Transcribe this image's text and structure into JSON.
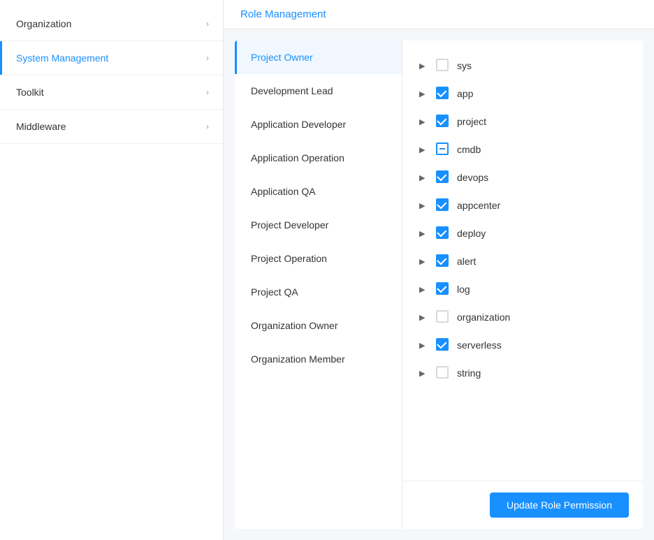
{
  "sidebar": {
    "items": [
      {
        "id": "organization",
        "label": "Organization",
        "active": false,
        "hasChevron": true
      },
      {
        "id": "system-management",
        "label": "System Management",
        "active": true,
        "hasChevron": true
      },
      {
        "id": "toolkit",
        "label": "Toolkit",
        "active": false,
        "hasChevron": true
      },
      {
        "id": "middleware",
        "label": "Middleware",
        "active": false,
        "hasChevron": true
      }
    ]
  },
  "page": {
    "title": "Role Management"
  },
  "roles": [
    {
      "id": "project-owner",
      "label": "Project Owner",
      "active": true
    },
    {
      "id": "development-lead",
      "label": "Development Lead",
      "active": false
    },
    {
      "id": "application-developer",
      "label": "Application Developer",
      "active": false
    },
    {
      "id": "application-operation",
      "label": "Application Operation",
      "active": false
    },
    {
      "id": "application-qa",
      "label": "Application QA",
      "active": false
    },
    {
      "id": "project-developer",
      "label": "Project Developer",
      "active": false
    },
    {
      "id": "project-operation",
      "label": "Project Operation",
      "active": false
    },
    {
      "id": "project-qa",
      "label": "Project QA",
      "active": false
    },
    {
      "id": "organization-owner",
      "label": "Organization Owner",
      "active": false
    },
    {
      "id": "organization-member",
      "label": "Organization Member",
      "active": false
    }
  ],
  "permissions": [
    {
      "id": "sys",
      "label": "sys",
      "state": "unchecked"
    },
    {
      "id": "app",
      "label": "app",
      "state": "checked"
    },
    {
      "id": "project",
      "label": "project",
      "state": "checked"
    },
    {
      "id": "cmdb",
      "label": "cmdb",
      "state": "partial"
    },
    {
      "id": "devops",
      "label": "devops",
      "state": "checked"
    },
    {
      "id": "appcenter",
      "label": "appcenter",
      "state": "checked"
    },
    {
      "id": "deploy",
      "label": "deploy",
      "state": "checked"
    },
    {
      "id": "alert",
      "label": "alert",
      "state": "checked"
    },
    {
      "id": "log",
      "label": "log",
      "state": "checked"
    },
    {
      "id": "organization",
      "label": "organization",
      "state": "unchecked"
    },
    {
      "id": "serverless",
      "label": "serverless",
      "state": "checked"
    },
    {
      "id": "string",
      "label": "string",
      "state": "unchecked"
    }
  ],
  "buttons": {
    "update_label": "Update Role Permission"
  }
}
